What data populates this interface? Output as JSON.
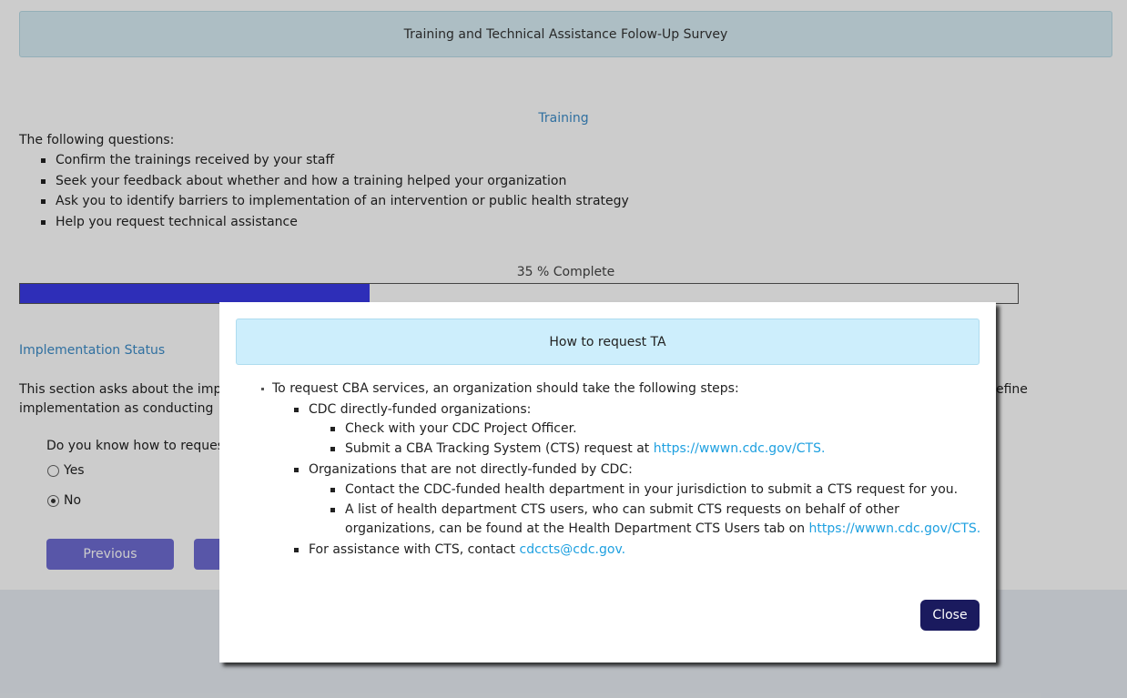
{
  "header": {
    "title": "Training and Technical Assistance Folow-Up Survey"
  },
  "section": {
    "title": "Training",
    "intro": "The following questions:",
    "bullets": [
      "Confirm the trainings received by your staff",
      "Seek your feedback about whether and how a training helped your organization",
      "Ask you to identify barriers to implementation of an intervention or public health strategy",
      "Help you request technical assistance"
    ]
  },
  "progress": {
    "label": "35 % Complete",
    "percent": 35
  },
  "implementation": {
    "title": "Implementation Status",
    "text_line1": "This section asks about the impl",
    "text_line1_right": "efine",
    "text_line2": "implementation as conducting",
    "question": "Do you know how to reques",
    "options": [
      {
        "label": "Yes",
        "checked": false
      },
      {
        "label": "No",
        "checked": true
      }
    ]
  },
  "nav": {
    "previous_label": "Previous"
  },
  "modal": {
    "title": "How to request TA",
    "intro": "To request CBA services, an organization should take the following steps:",
    "group1_title": "CDC directly-funded organizations:",
    "group1_item1": "Check with your CDC Project Officer.",
    "group1_item2_text": "Submit a CBA Tracking System (CTS) request at ",
    "group1_item2_link": "https://wwwn.cdc.gov/CTS.",
    "group2_title": "Organizations that are not directly-funded by CDC:",
    "group2_item1": "Contact the CDC-funded health department in your jurisdiction to submit a CTS request for you.",
    "group2_item2_text": "A list of health department CTS users, who can submit CTS requests on behalf of other organizations, can be found at the Health Department CTS Users tab on ",
    "group2_item2_link": "https://wwwn.cdc.gov/CTS.",
    "assist_text": "For assistance with CTS, contact ",
    "assist_link": "cdccts@cdc.gov.",
    "close_label": "Close"
  },
  "colors": {
    "progress_fill": "#3a3ae6",
    "link": "#1ea0e0",
    "close_button": "#1a1a5e"
  }
}
